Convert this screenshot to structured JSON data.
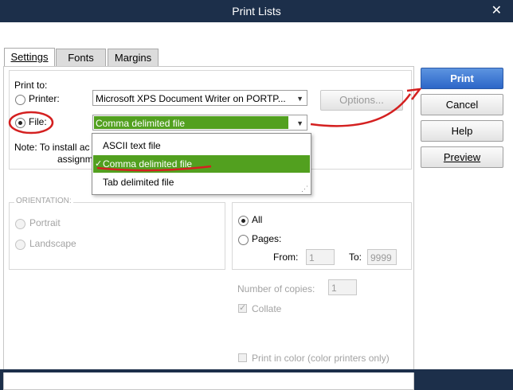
{
  "window": {
    "title": "Print Lists",
    "close_glyph": "✕"
  },
  "tabs": [
    {
      "label": "Settings",
      "active": true
    },
    {
      "label": "Fonts",
      "active": false
    },
    {
      "label": "Margins",
      "active": false
    }
  ],
  "print_to": {
    "label": "Print to:",
    "printer_label": "Printer:",
    "printer_value": "Microsoft XPS Document Writer on PORTP...",
    "options_button": "Options...",
    "file_label": "File:",
    "file_value": "Comma delimited file",
    "note_part1": "Note: To install ac",
    "note_part2": "assignmer"
  },
  "file_dropdown": {
    "options": [
      "ASCII text file",
      "Comma delimited file",
      "Tab delimited file"
    ],
    "selected_index": 1,
    "check_glyph": "✓"
  },
  "orientation": {
    "label": "ORIENTATION:",
    "portrait": "Portrait",
    "landscape": "Landscape"
  },
  "page_range": {
    "all": "All",
    "pages": "Pages:",
    "from_label": "From:",
    "from_value": "1",
    "to_label": "To:",
    "to_value": "9999"
  },
  "copies": {
    "label": "Number of copies:",
    "value": "1"
  },
  "collate": {
    "label": "Collate",
    "checked": true
  },
  "print_color": {
    "label": "Print in color (color printers only)",
    "checked": false
  },
  "buttons": {
    "print": "Print",
    "cancel": "Cancel",
    "help": "Help",
    "preview": "Preview"
  },
  "colors": {
    "title_bar": "#1c2f4a",
    "selection_green": "#52a01f",
    "print_blue": "#2c66c8",
    "annotation_red": "#d42020"
  },
  "icons": {
    "dropdown_arrow": "▼",
    "check": "✓"
  }
}
